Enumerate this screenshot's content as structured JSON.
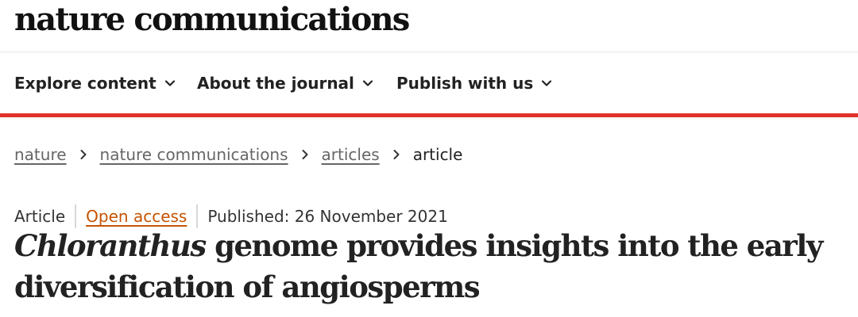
{
  "header": {
    "brand": "nature communications"
  },
  "nav": {
    "items": [
      {
        "label": "Explore content",
        "icon": "chevron-down-icon"
      },
      {
        "label": "About the journal",
        "icon": "chevron-down-icon"
      },
      {
        "label": "Publish with us",
        "icon": "chevron-down-icon"
      }
    ]
  },
  "breadcrumb": {
    "items": [
      "nature",
      "nature communications",
      "articles"
    ],
    "current": "article",
    "separator_icon": "chevron-right-icon"
  },
  "article": {
    "type": "Article",
    "access": "Open access",
    "published": "Published: 26 November 2021",
    "title_italic": "Chloranthus",
    "title_rest": " genome provides insights into the early diversification of angiosperms"
  },
  "colors": {
    "accent_red": "#e0332b",
    "open_access": "#c65301"
  }
}
